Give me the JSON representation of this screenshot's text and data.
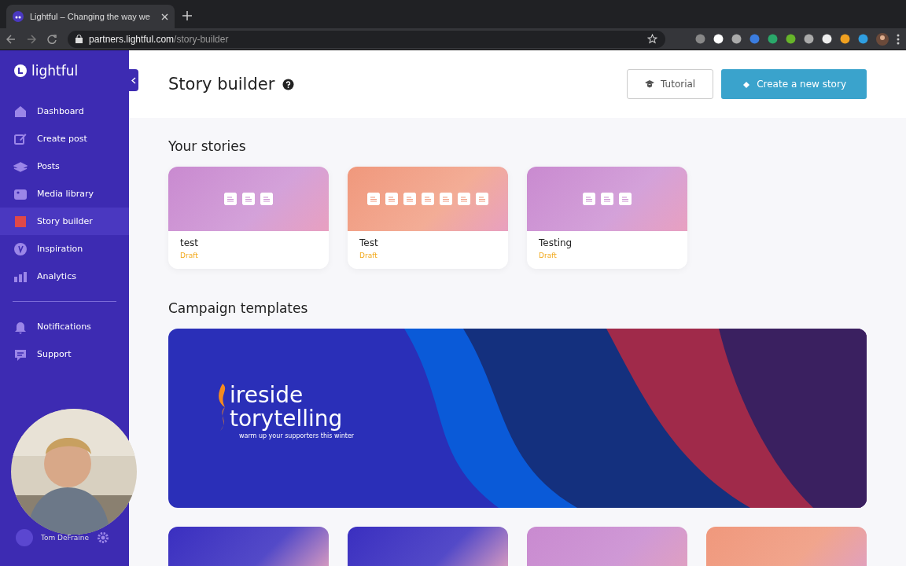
{
  "browser": {
    "tab_title": "Lightful – Changing the way we",
    "url_host": "partners.lightful.com",
    "url_path": "/story-builder"
  },
  "sidebar": {
    "logo": "lightful",
    "items": [
      {
        "label": "Dashboard",
        "selected": false
      },
      {
        "label": "Create post",
        "selected": false
      },
      {
        "label": "Posts",
        "selected": false
      },
      {
        "label": "Media library",
        "selected": false
      },
      {
        "label": "Story builder",
        "selected": true
      },
      {
        "label": "Inspiration",
        "selected": false
      },
      {
        "label": "Analytics",
        "selected": false
      }
    ],
    "secondary_items": [
      {
        "label": "Notifications",
        "selected": false
      },
      {
        "label": "Support",
        "selected": false
      }
    ],
    "user": {
      "name": "Tom DeFraine"
    }
  },
  "header": {
    "title": "Story builder",
    "buttons": [
      {
        "label": "Tutorial",
        "kind": "outline"
      },
      {
        "label": "Create a new story",
        "kind": "primary"
      }
    ]
  },
  "your_stories": {
    "heading": "Your stories",
    "stories": [
      {
        "title": "test",
        "status": "Draft",
        "color": "#c98ad0",
        "pages": [
          {
            "kind": "page"
          },
          {
            "kind": "page"
          },
          {
            "kind": "page"
          }
        ]
      },
      {
        "title": "Test",
        "status": "Draft",
        "color": "#f0987c",
        "pages": [
          {
            "kind": "page"
          },
          {
            "kind": "page"
          },
          {
            "kind": "page"
          },
          {
            "kind": "page"
          },
          {
            "kind": "page"
          },
          {
            "kind": "page"
          },
          {
            "kind": "page"
          }
        ]
      },
      {
        "title": "Testing",
        "status": "Draft",
        "color": "#c98ad0",
        "pages": [
          {
            "kind": "page"
          },
          {
            "kind": "page"
          },
          {
            "kind": "page"
          }
        ]
      }
    ]
  },
  "campaign_templates": {
    "heading": "Campaign templates",
    "featured": {
      "title_part_1": "ireside",
      "title_part_2": "torytelling",
      "tagline": "warm up your supporters this winter"
    },
    "templates": [
      {
        "color": "#3a2fc0"
      },
      {
        "color": "#3a2fc0"
      },
      {
        "color": "#c98ad0"
      },
      {
        "color": "#f0987c"
      }
    ]
  }
}
